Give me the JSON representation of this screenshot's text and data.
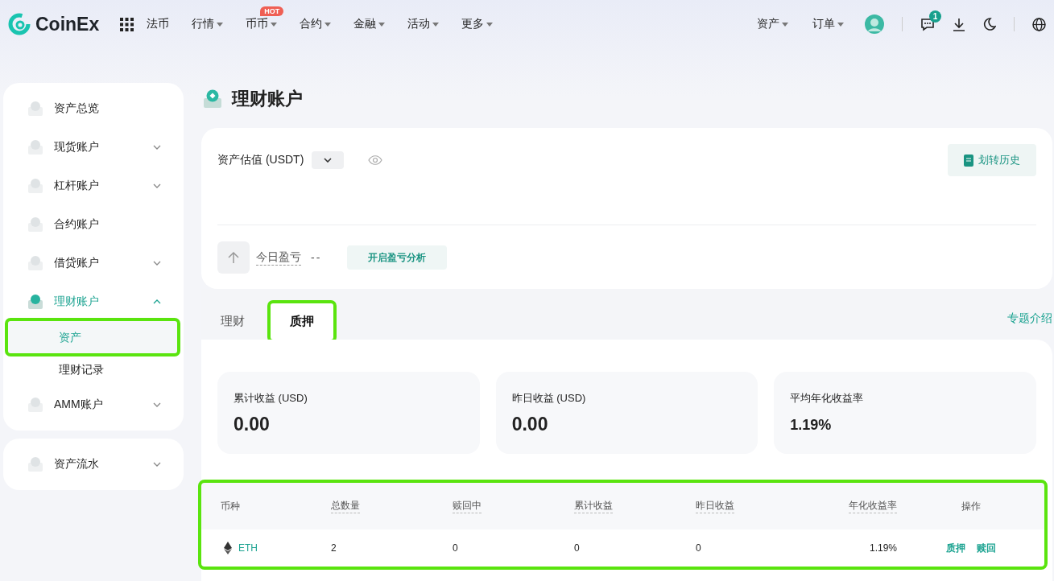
{
  "nav": {
    "logo": "CoinEx",
    "items": [
      {
        "label": "法币",
        "dropdown": false
      },
      {
        "label": "行情",
        "dropdown": true
      },
      {
        "label": "币币",
        "dropdown": true,
        "badge": "HOT"
      },
      {
        "label": "合约",
        "dropdown": true
      },
      {
        "label": "金融",
        "dropdown": true
      },
      {
        "label": "活动",
        "dropdown": true
      },
      {
        "label": "更多",
        "dropdown": true
      }
    ],
    "right_items": [
      {
        "label": "资产",
        "dropdown": true
      },
      {
        "label": "订单",
        "dropdown": true
      }
    ],
    "message_count": "1"
  },
  "sidebar": {
    "groups": [
      {
        "items": [
          {
            "label": "资产总览",
            "kind": "link",
            "selected": false
          },
          {
            "label": "现货账户",
            "kind": "group",
            "expanded": false,
            "selected": false
          },
          {
            "label": "杠杆账户",
            "kind": "group",
            "expanded": false,
            "selected": false
          },
          {
            "label": "合约账户",
            "kind": "link",
            "selected": false
          },
          {
            "label": "借贷账户",
            "kind": "group",
            "expanded": false,
            "selected": false
          },
          {
            "label": "理财账户",
            "kind": "group",
            "expanded": true,
            "selected": true,
            "children": [
              {
                "label": "资产",
                "selected": true,
                "highlighted": true
              },
              {
                "label": "理财记录",
                "selected": false,
                "highlighted": false
              }
            ]
          },
          {
            "label": "AMM账户",
            "kind": "group",
            "expanded": false,
            "selected": false
          }
        ]
      },
      {
        "items": [
          {
            "label": "资产流水",
            "kind": "group",
            "expanded": false,
            "selected": false
          }
        ]
      }
    ]
  },
  "page_title": "理财账户",
  "summary": {
    "label": "资产估值 (USDT)",
    "history_button": "划转历史",
    "pnl_label": "今日盈亏",
    "pnl_value": "--",
    "pnl_button": "开启盈亏分析"
  },
  "tabs": [
    {
      "label": "理财",
      "selected": false,
      "highlighted": false
    },
    {
      "label": "质押",
      "selected": true,
      "highlighted": true
    }
  ],
  "topic_link": "专题介绍",
  "stats": [
    {
      "label": "累计收益 (USD)",
      "value": "0.00"
    },
    {
      "label": "昨日收益 (USD)",
      "value": "0.00"
    },
    {
      "label": "平均年化收益率",
      "value": "1.19%"
    }
  ],
  "table": {
    "highlighted": true,
    "columns": [
      {
        "label": "币种",
        "hint": false
      },
      {
        "label": "总数量",
        "hint": true
      },
      {
        "label": "赎回中",
        "hint": true
      },
      {
        "label": "累计收益",
        "hint": true
      },
      {
        "label": "昨日收益",
        "hint": true
      },
      {
        "label": "年化收益率",
        "hint": true
      },
      {
        "label": "操作",
        "hint": false
      }
    ],
    "rows": [
      {
        "cells": [
          "ETH",
          "2",
          "0",
          "0",
          "0",
          "1.19%"
        ],
        "actions": [
          "质押",
          "赎回"
        ]
      }
    ]
  }
}
